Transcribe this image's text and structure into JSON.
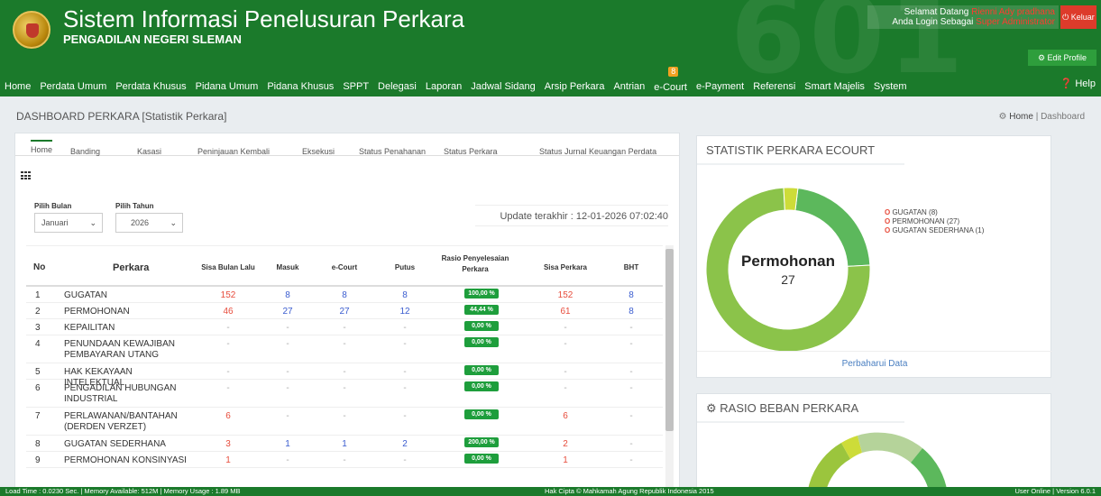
{
  "header": {
    "title": "Sistem Informasi Penelusuran Perkara",
    "subtitle": "PENGADILAN NEGERI SLEMAN",
    "bg_text": "601",
    "welcome_line1_prefix": "Selamat Datang",
    "welcome_user": "Rienni Ady pradhana",
    "welcome_line2_prefix": "Anda Login Sebagai",
    "welcome_role": "Super Administrator",
    "logout_label": "⏻ Keluar",
    "edit_profile_label": "⚙ Edit Profile"
  },
  "nav": {
    "items": [
      "Home",
      "Perdata Umum",
      "Perdata Khusus",
      "Pidana Umum",
      "Pidana Khusus",
      "SPPT",
      "Delegasi",
      "Laporan",
      "Jadwal Sidang",
      "Arsip Perkara",
      "Antrian",
      "e-Court",
      "e-Payment",
      "Referensi",
      "Smart Majelis",
      "System"
    ],
    "ecourt_badge": "8",
    "help_label": "❓ Help"
  },
  "page": {
    "title": "DASHBOARD PERKARA  [Statistik Perkara]",
    "breadcrumb_home": "Home",
    "breadcrumb_sep": "|",
    "breadcrumb_current": "Dashboard"
  },
  "tabs": [
    "Home",
    "Banding",
    "Kasasi",
    "Peninjauan Kembali",
    "Eksekusi",
    "Status Penahanan",
    "Status Perkara",
    "Status Jurnal Keuangan Perdata"
  ],
  "filters": {
    "month_label": "Pilih Bulan",
    "month_value": "Januari",
    "year_label": "Pilih Tahun",
    "year_value": "2026"
  },
  "update_text": "Update terakhir : 12-01-2026 07:02:40",
  "table": {
    "headers": [
      "No",
      "Perkara",
      "Sisa Bulan Lalu",
      "Masuk",
      "e-Court",
      "Putus",
      "Rasio Penyelesaian Perkara",
      "Sisa Perkara",
      "BHT"
    ],
    "rows": [
      {
        "no": "1",
        "perkara": "GUGATAN",
        "sisa_lalu": "152",
        "masuk": "8",
        "ecourt": "8",
        "putus": "8",
        "rasio": "100,00 %",
        "sisa": "152",
        "bht": "8"
      },
      {
        "no": "2",
        "perkara": "PERMOHONAN",
        "sisa_lalu": "46",
        "masuk": "27",
        "ecourt": "27",
        "putus": "12",
        "rasio": "44,44 %",
        "sisa": "61",
        "bht": "8"
      },
      {
        "no": "3",
        "perkara": "KEPAILITAN",
        "sisa_lalu": "-",
        "masuk": "-",
        "ecourt": "-",
        "putus": "-",
        "rasio": "0,00 %",
        "sisa": "-",
        "bht": "-"
      },
      {
        "no": "4",
        "perkara": "PENUNDAAN KEWAJIBAN PEMBAYARAN UTANG",
        "sisa_lalu": "-",
        "masuk": "-",
        "ecourt": "-",
        "putus": "-",
        "rasio": "0,00 %",
        "sisa": "-",
        "bht": "-"
      },
      {
        "no": "5",
        "perkara": "HAK KEKAYAAN INTELEKTUAL",
        "sisa_lalu": "-",
        "masuk": "-",
        "ecourt": "-",
        "putus": "-",
        "rasio": "0,00 %",
        "sisa": "-",
        "bht": "-"
      },
      {
        "no": "6",
        "perkara": "PENGADILAN HUBUNGAN INDUSTRIAL",
        "sisa_lalu": "-",
        "masuk": "-",
        "ecourt": "-",
        "putus": "-",
        "rasio": "0,00 %",
        "sisa": "-",
        "bht": "-"
      },
      {
        "no": "7",
        "perkara": "PERLAWANAN/BANTAHAN (DERDEN VERZET)",
        "sisa_lalu": "6",
        "masuk": "-",
        "ecourt": "-",
        "putus": "-",
        "rasio": "0,00 %",
        "sisa": "6",
        "bht": "-"
      },
      {
        "no": "8",
        "perkara": "GUGATAN SEDERHANA",
        "sisa_lalu": "3",
        "masuk": "1",
        "ecourt": "1",
        "putus": "2",
        "rasio": "200,00 %",
        "sisa": "2",
        "bht": "-"
      },
      {
        "no": "9",
        "perkara": "PERMOHONAN KONSINYASI",
        "sisa_lalu": "1",
        "masuk": "-",
        "ecourt": "-",
        "putus": "-",
        "rasio": "0,00 %",
        "sisa": "1",
        "bht": "-"
      }
    ]
  },
  "ecourt_panel": {
    "title": "STATISTIK PERKARA ECOURT",
    "center_label": "Permohonan",
    "center_value": "27",
    "legend": [
      "GUGATAN (8)",
      "PERMOHONAN (27)",
      "GUGATAN SEDERHANA (1)"
    ],
    "refresh_label": "Perbaharui Data"
  },
  "chart_data": [
    {
      "type": "pie",
      "title": "STATISTIK PERKARA ECOURT",
      "categories": [
        "GUGATAN",
        "PERMOHONAN",
        "GUGATAN SEDERHANA"
      ],
      "values": [
        8,
        27,
        1
      ],
      "colors": [
        "#5cb85c",
        "#8bc34a",
        "#cddc39"
      ],
      "legend": "right"
    }
  ],
  "rasio_panel": {
    "title": "RASIO BEBAN PERKARA"
  },
  "footer": {
    "left": "Load Time : 0.0230 Sec. | Memory Available: 512M | Memory Usage : 1.89 MB",
    "center": "Hak Cipta © Mahkamah Agung Republik Indonesia 2015",
    "right": "User Online | Version 6.0.1"
  },
  "colors": {
    "primary": "#1b7a2b",
    "danger": "#dd3b2b",
    "ratio_badge": "#1e9e3c",
    "value_red": "#e74c3c",
    "value_blue": "#3a5ccf"
  }
}
